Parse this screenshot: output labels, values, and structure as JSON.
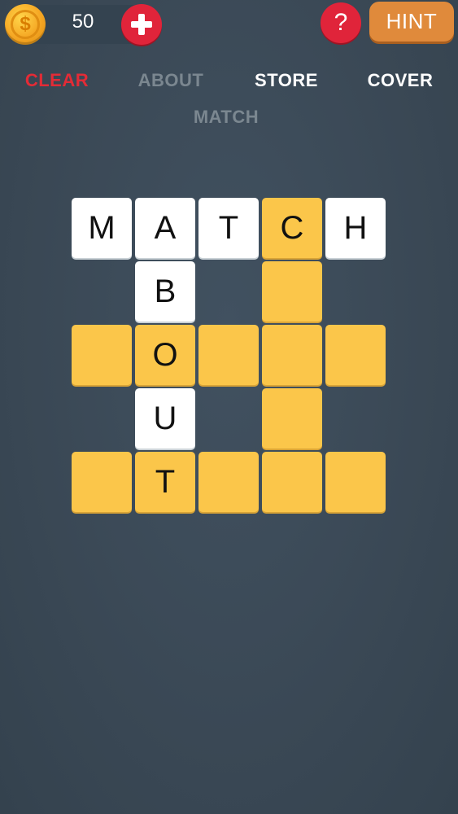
{
  "topbar": {
    "coin_symbol": "$",
    "coins": "50",
    "help_label": "?",
    "hint_label": "HINT"
  },
  "words": {
    "clear": "CLEAR",
    "about": "ABOUT",
    "store": "STORE",
    "cover": "COVER",
    "match": "MATCH"
  },
  "colors": {
    "background": "#3c4b58",
    "tile_filled": "#ffffff",
    "tile_empty": "#fbc64a",
    "selected_word": "#e32b36",
    "pending_word": "#7b8790",
    "hint_button": "#e08a3b",
    "red_button": "#e0243a"
  },
  "grid": {
    "r0c0": "M",
    "r0c1": "A",
    "r0c2": "T",
    "r0c3": "C",
    "r0c4": "H",
    "r1c1": "B",
    "r1c3": "",
    "r2c0": "",
    "r2c1": "O",
    "r2c2": "",
    "r2c3": "",
    "r2c4": "",
    "r3c1": "U",
    "r3c3": "",
    "r4c0": "",
    "r4c1": "T",
    "r4c2": "",
    "r4c3": "",
    "r4c4": ""
  }
}
